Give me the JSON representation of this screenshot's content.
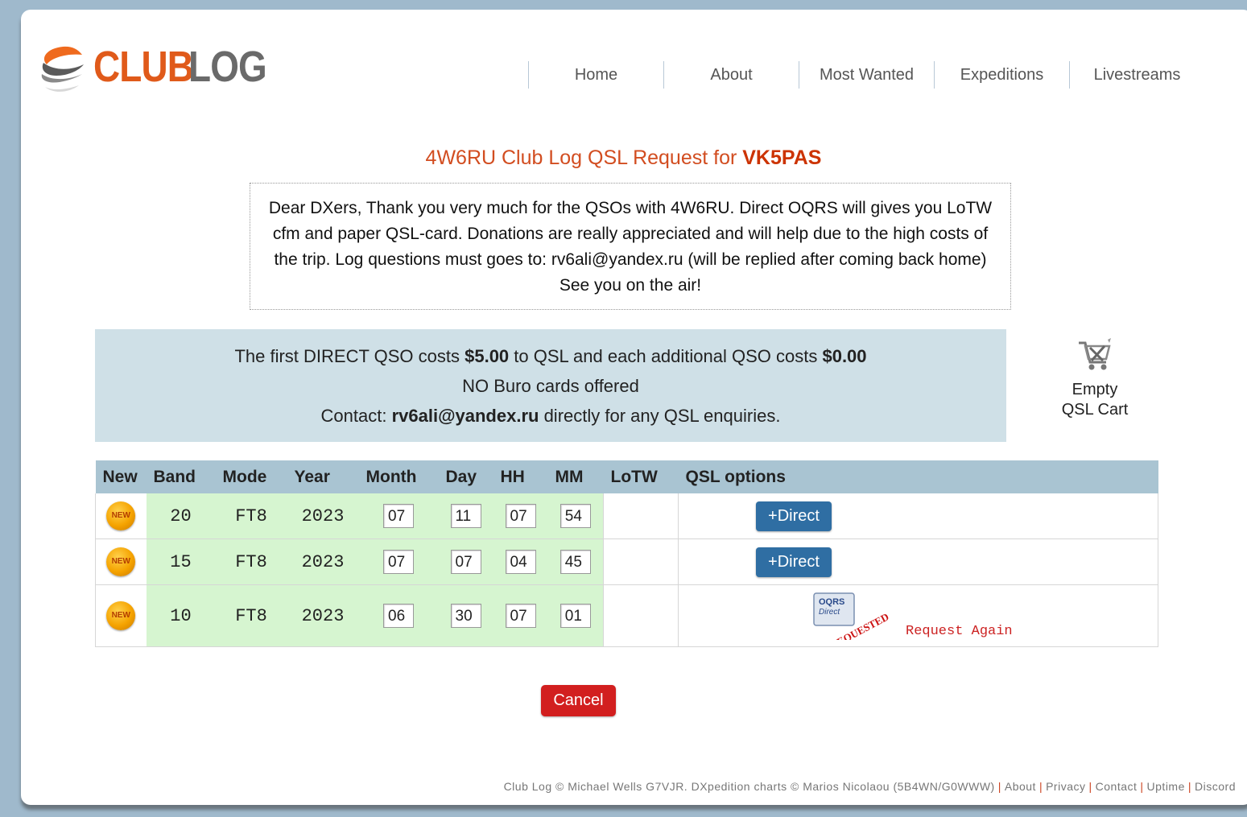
{
  "header": {
    "logo_text_a": "CLUB",
    "logo_text_b": "LOG",
    "nav": [
      "Home",
      "About",
      "Most Wanted",
      "Expeditions",
      "Livestreams"
    ]
  },
  "title": {
    "prefix": "4W6RU Club Log QSL Request for ",
    "callsign": "VK5PAS"
  },
  "notice": "Dear DXers, Thank you very much for the QSOs with 4W6RU. Direct OQRS will gives you LoTW cfm and paper QSL-card. Donations are really appreciated and will help due to the high costs of the trip. Log questions must goes to: rv6ali@yandex.ru (will be replied after coming back home) See you on the air!",
  "pricing": {
    "line1_a": "The first DIRECT QSO costs ",
    "first_cost": "$5.00",
    "line1_b": " to QSL and each additional QSO costs ",
    "add_cost": "$0.00",
    "line2": "NO Buro cards offered",
    "line3_a": "Contact: ",
    "contact": "rv6ali@yandex.ru",
    "line3_b": " directly for any QSL enquiries."
  },
  "cart": {
    "line1": "Empty",
    "line2": "QSL Cart",
    "icon": "cart-icon"
  },
  "table": {
    "headers": [
      "New",
      "Band",
      "Mode",
      "Year",
      "Month",
      "Day",
      "HH",
      "MM",
      "LoTW",
      "QSL options"
    ],
    "new_badge": "NEW",
    "rows": [
      {
        "band": "20",
        "mode": "FT8",
        "year": "2023",
        "month": "07",
        "day": "11",
        "hh": "07",
        "mm": "54",
        "lotw": "",
        "option": "+Direct"
      },
      {
        "band": "15",
        "mode": "FT8",
        "year": "2023",
        "month": "07",
        "day": "07",
        "hh": "04",
        "mm": "45",
        "lotw": "",
        "option": "+Direct"
      },
      {
        "band": "10",
        "mode": "FT8",
        "year": "2023",
        "month": "06",
        "day": "30",
        "hh": "07",
        "mm": "01",
        "lotw": "",
        "stamp_line1": "OQRS",
        "stamp_line2": "Direct",
        "stamp_text": "REQUESTED",
        "request_again": "Request Again"
      }
    ]
  },
  "cancel": "Cancel",
  "footer": {
    "credit": "Club Log © Michael Wells G7VJR. DXpedition charts © Marios Nicolaou (5B4WN/G0WWW)",
    "links": [
      "About",
      "Privacy",
      "Contact",
      "Uptime",
      "Discord"
    ]
  }
}
